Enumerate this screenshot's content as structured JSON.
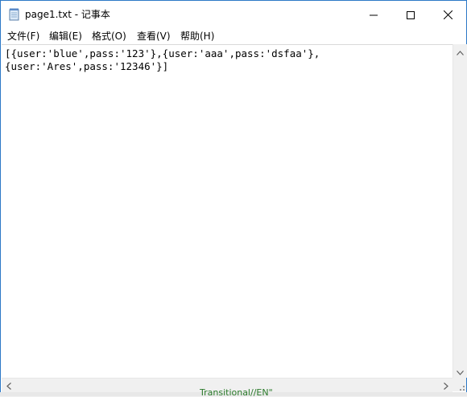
{
  "window": {
    "title": "page1.txt - 记事本",
    "icon": "notepad-icon",
    "controls": {
      "minimize_icon": "minimize-icon",
      "maximize_icon": "maximize-icon",
      "close_icon": "close-icon"
    }
  },
  "menubar": {
    "items": [
      {
        "label": "文件(F)"
      },
      {
        "label": "编辑(E)"
      },
      {
        "label": "格式(O)"
      },
      {
        "label": "查看(V)"
      },
      {
        "label": "帮助(H)"
      }
    ]
  },
  "editor": {
    "lines": [
      "[{user:'blue',pass:'123'},{user:'aaa',pass:'dsfaa'},",
      "{user:'Ares',pass:'12346'}]"
    ]
  },
  "background": {
    "partial_text": "Transitional//EN\""
  },
  "colors": {
    "border_accent": "#2d79c7",
    "background_text": "#2a7a2a"
  }
}
